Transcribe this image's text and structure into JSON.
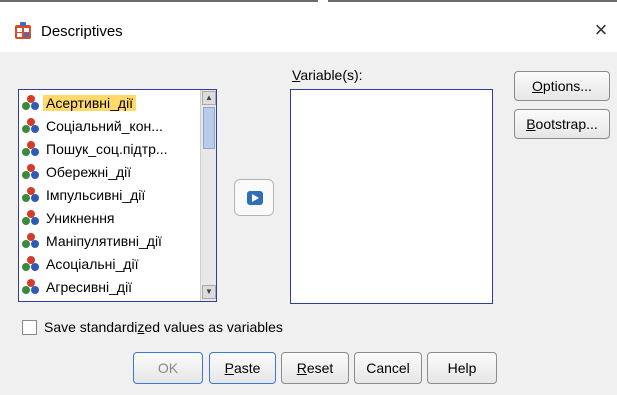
{
  "window": {
    "title": "Descriptives",
    "close_glyph": "×"
  },
  "source_list": {
    "items": [
      {
        "label": "Асертивні_дії",
        "selected": true
      },
      {
        "label": "Соціальний_кон...",
        "selected": false
      },
      {
        "label": "Пошук_соц.підтр...",
        "selected": false
      },
      {
        "label": "Обережні_дії",
        "selected": false
      },
      {
        "label": "Імпульсивні_дії",
        "selected": false
      },
      {
        "label": "Уникнення",
        "selected": false
      },
      {
        "label": "Маніпулятивні_дії",
        "selected": false
      },
      {
        "label": "Асоціальні_дії",
        "selected": false
      },
      {
        "label": "Агресивні_дії",
        "selected": false
      }
    ]
  },
  "target": {
    "label_mn": "V",
    "label_rest": "ariable(s):"
  },
  "buttons": {
    "options_mn": "O",
    "options_rest": "ptions...",
    "bootstrap_mn": "B",
    "bootstrap_rest": "ootstrap...",
    "ok": "OK",
    "paste_mn": "P",
    "paste_rest": "aste",
    "reset_mn": "R",
    "reset_rest": "eset",
    "cancel": "Cancel",
    "help": "Help"
  },
  "checkbox": {
    "label_pre": "Save standardi",
    "label_mn": "z",
    "label_post": "ed values as variables",
    "checked": false
  },
  "colors": {
    "selection": "#ffd96a",
    "list_border": "#2f3f9f",
    "arrow": "#2e6fb8"
  }
}
